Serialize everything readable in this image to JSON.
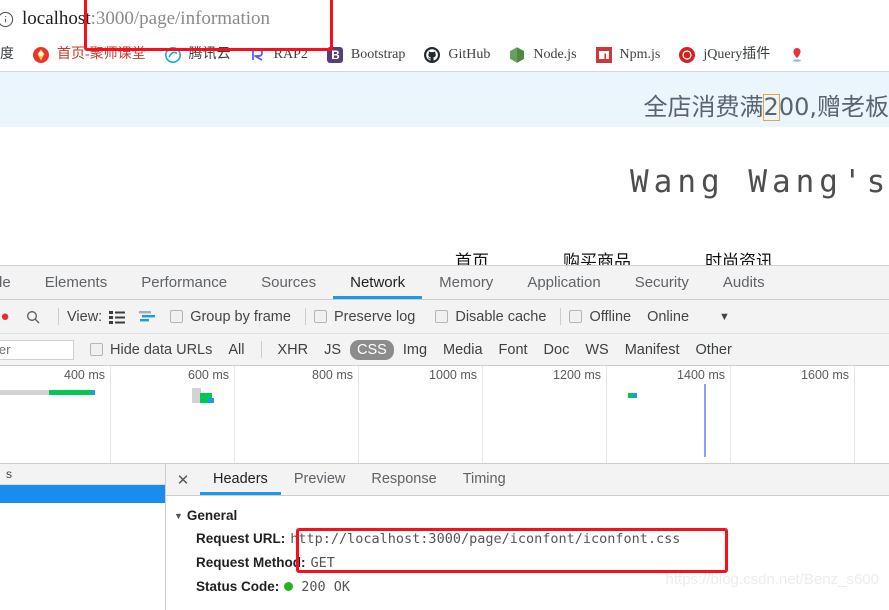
{
  "browser": {
    "omnibox": {
      "icon": "info-circle-icon",
      "host": "localhost",
      "path": ":3000/page/information",
      "full_url": "localhost:3000/page/information"
    },
    "bookmarks": [
      {
        "icon": "baidu-icon",
        "label": "度"
      },
      {
        "icon": "jushi-icon",
        "label": "首页-聚师课堂"
      },
      {
        "icon": "tencent-cloud-icon",
        "label": "腾讯云"
      },
      {
        "icon": "rap2-icon",
        "label": "RAP2"
      },
      {
        "icon": "bootstrap-icon",
        "label": "Bootstrap"
      },
      {
        "icon": "github-icon",
        "label": "GitHub"
      },
      {
        "icon": "nodejs-icon",
        "label": "Node.js"
      },
      {
        "icon": "npm-icon",
        "label": "Npm.js"
      },
      {
        "icon": "jquery-icon",
        "label": "jQuery插件"
      },
      {
        "icon": "pin-icon",
        "label": ""
      }
    ]
  },
  "page": {
    "promo": {
      "before": "全店消费满",
      "highlight": "2",
      "after": "00,赠老板",
      "highlight_color": "#e8a33d"
    },
    "shop_title": "Wang Wang's",
    "nav": [
      "首页",
      "购买商品",
      "时尚资讯"
    ]
  },
  "devtools": {
    "panel_tabs": [
      {
        "label": "le",
        "selected": false
      },
      {
        "label": "Elements",
        "selected": false
      },
      {
        "label": "Performance",
        "selected": false
      },
      {
        "label": "Sources",
        "selected": false
      },
      {
        "label": "Network",
        "selected": true
      },
      {
        "label": "Memory",
        "selected": false
      },
      {
        "label": "Application",
        "selected": false
      },
      {
        "label": "Security",
        "selected": false
      },
      {
        "label": "Audits",
        "selected": false
      }
    ],
    "toolbar": {
      "record_icon": "record-icon",
      "clear_icon": "clear-icon",
      "filter_icon": "search-icon",
      "view_label": "View:",
      "view_list_icon": "list-view-icon",
      "view_waterfall_icon": "waterfall-view-icon",
      "group_by_frame": "Group by frame",
      "preserve_log": "Preserve log",
      "disable_cache": "Disable cache",
      "offline": "Offline",
      "throttling": "Online",
      "throttling_caret": "chevron-down-icon"
    },
    "filterbar": {
      "filter_placeholder": "Filter",
      "filter_value": "",
      "hide_data_urls": "Hide data URLs",
      "types": [
        {
          "label": "All",
          "selected": false
        },
        {
          "label": "XHR",
          "selected": false
        },
        {
          "label": "JS",
          "selected": false
        },
        {
          "label": "CSS",
          "selected": true
        },
        {
          "label": "Img",
          "selected": false
        },
        {
          "label": "Media",
          "selected": false
        },
        {
          "label": "Font",
          "selected": false
        },
        {
          "label": "Doc",
          "selected": false
        },
        {
          "label": "WS",
          "selected": false
        },
        {
          "label": "Manifest",
          "selected": false
        },
        {
          "label": "Other",
          "selected": false
        }
      ]
    },
    "overview": {
      "ticks": [
        "400 ms",
        "600 ms",
        "800 ms",
        "1000 ms",
        "1200 ms",
        "1400 ms",
        "1600 ms"
      ],
      "accent_green": "#00c853",
      "accent_blue": "#1a9ae8",
      "accent_gray": "#d3d3d3",
      "event_line_color": "#8c9eff"
    },
    "request_list": {
      "column_header": "s",
      "rows": [
        {
          "name": "",
          "selected": true
        }
      ]
    },
    "detail": {
      "close_icon": "close-icon",
      "tabs": [
        {
          "label": "Headers",
          "selected": true
        },
        {
          "label": "Preview",
          "selected": false
        },
        {
          "label": "Response",
          "selected": false
        },
        {
          "label": "Timing",
          "selected": false
        }
      ],
      "general": {
        "section_title": "General",
        "caret": "triangle-down-icon",
        "rows": [
          {
            "key": "Request URL:",
            "value": "http://localhost:3000/page/iconfont/iconfont.css"
          },
          {
            "key": "Request Method:",
            "value": "GET"
          },
          {
            "key": "Status Code:",
            "value": "200 OK",
            "status_dot": "#23b423"
          }
        ]
      }
    }
  },
  "annotations": {
    "box_color": "#fb0d1b",
    "url_box": "highlight around omnibox URL",
    "request_url_box": "highlight around Request URL value"
  },
  "watermark": "https://blog.csdn.net/Benz_s600"
}
